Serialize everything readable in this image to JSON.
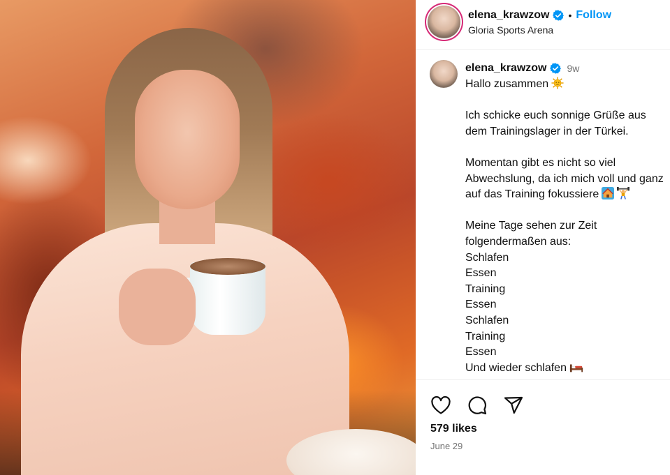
{
  "post": {
    "image_alt": "",
    "header": {
      "username": "elena_krawzow",
      "dot": "•",
      "follow_label": "Follow",
      "location": "Gloria Sports Arena"
    },
    "caption": {
      "username": "elena_krawzow",
      "time_ago": "9w",
      "lines": [
        "Hallo zusammen",
        "",
        "Ich schicke euch sonnige Grüße aus",
        "dem Trainingslager in der Türkei.",
        "",
        "Momentan gibt es nicht so viel",
        "Abwechslung, da ich mich voll und ganz",
        "auf das Training fokussiere",
        "",
        "Meine Tage sehen zur Zeit",
        "folgendermaßen aus:",
        "Schlafen",
        "Essen",
        "Training",
        "Essen",
        "Schlafen",
        "Training",
        "Essen",
        "Und wieder schlafen"
      ],
      "emojis": [
        "sun-emoji",
        "house-emoji",
        "weightlifter-emoji",
        "bed-emoji"
      ]
    },
    "footer": {
      "likes": "579 likes",
      "date": "June 29"
    },
    "icons": {
      "like": "heart-icon",
      "comment": "comment-icon",
      "share": "share-icon",
      "verified": "verified-badge-icon"
    },
    "colors": {
      "accent_blue": "#0095f6",
      "verified_blue": "#0095f6",
      "secondary_text": "#737373",
      "story_ring": "#d62976"
    }
  }
}
